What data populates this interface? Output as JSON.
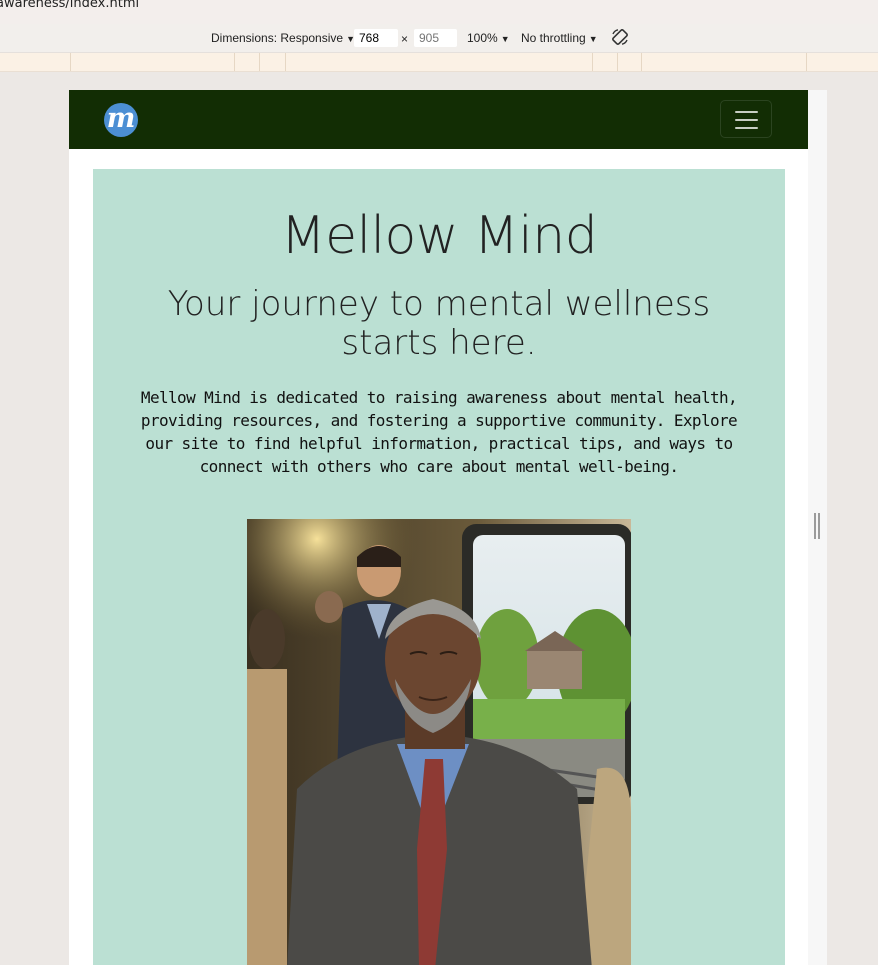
{
  "browser": {
    "url_fragment": "awareness/index.html"
  },
  "devtools": {
    "dimensions_label": "Dimensions: Responsive",
    "width_value": "768",
    "times": "×",
    "height_placeholder": "905",
    "zoom": "100%",
    "throttling": "No throttling",
    "caret": "▼"
  },
  "site": {
    "logo_letter": "m",
    "hero": {
      "title": "Mellow Mind",
      "subtitle": "Your journey to mental wellness starts here.",
      "intro": "Mellow Mind is dedicated to raising awareness about mental health, providing resources, and fostering a supportive community. Explore our site to find helpful information, practical tips, and ways to connect with others who care about mental well-being."
    }
  },
  "colors": {
    "navbar": "#122d04",
    "hero_background": "#bbe0d3",
    "logo": "#4c8fd4"
  },
  "icons": [
    "hamburger-menu-icon",
    "rotate-device-icon",
    "dropdown-caret-icon"
  ]
}
